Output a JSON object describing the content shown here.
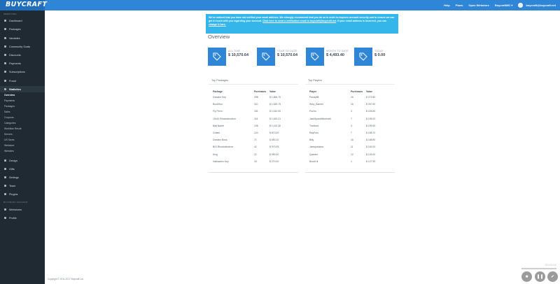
{
  "header": {
    "logo": "BUYCRAFT",
    "links": [
      "Help",
      "Plans",
      "Open Webstore",
      "BuycraftMC ▾"
    ],
    "user_email": "buycraft@buycraft.net",
    "colors": {
      "topbar": "#2f86d6",
      "sidebar": "#1f2a33",
      "accent": "#2f86d6",
      "notice": "#34b6eb"
    }
  },
  "sidebar": {
    "section_webstore": "WEBSTORE",
    "items_top": [
      {
        "label": "Dashboard",
        "icon": "dashboard-icon"
      },
      {
        "label": "Packages",
        "icon": "package-icon"
      },
      {
        "label": "Variables",
        "icon": "variable-icon"
      },
      {
        "label": "Community Goals",
        "icon": "goal-icon"
      },
      {
        "label": "Discounts",
        "icon": "discount-icon"
      },
      {
        "label": "Payments",
        "icon": "payment-icon"
      },
      {
        "label": "Subscriptions",
        "icon": "subscription-icon"
      },
      {
        "label": "Fraud",
        "icon": "fraud-icon"
      },
      {
        "label": "Statistics",
        "icon": "statistics-icon"
      }
    ],
    "stat_sub": [
      "Overview",
      "Payments",
      "Packages",
      "Sales",
      "Coupons",
      "Categories",
      "Workflow Result",
      "Servers",
      "US Taxes",
      "Webstore",
      "Websites"
    ],
    "items_mid": [
      {
        "label": "Design",
        "icon": "design-icon"
      },
      {
        "label": "Gifts",
        "icon": "gift-icon"
      },
      {
        "label": "Settings",
        "icon": "settings-icon"
      },
      {
        "label": "Team",
        "icon": "team-icon"
      },
      {
        "label": "Plugins",
        "icon": "plugin-icon"
      }
    ],
    "section_account": "BUYCRAFT ACCOUNT",
    "items_bottom": [
      {
        "label": "Webstores",
        "icon": "webstore-icon"
      },
      {
        "label": "Profile",
        "icon": "profile-icon"
      }
    ]
  },
  "notice": {
    "text1": "We've noticed that you have not verified your email address. We strongly recommend that you do so in order to improve account security and to ensure we can get in touch with you regarding your account.",
    "link1": "Click here to send a verification email to buycraft@buycraft.net",
    "text2": ". If your email address is incorrect, you can",
    "link2": "change it here."
  },
  "page": {
    "title": "Overview"
  },
  "stats": [
    {
      "label": "ALL TIME",
      "value": "$ 10,570.64"
    },
    {
      "label": "YEAR TO DATE",
      "value": "$ 10,570.64"
    },
    {
      "label": "MONTH TO DATE",
      "value": "$ 4,493.40"
    },
    {
      "label": "TODAY",
      "value": "$ 0.00"
    }
  ],
  "top_packages": {
    "title": "Top Packages",
    "headers": [
      "Package",
      "Purchases",
      "Value"
    ],
    "rows": [
      [
        "Donator Key",
        "298",
        "$ 1,666.70"
      ],
      [
        "BookSun",
        "110",
        "$ 1,549.75"
      ],
      [
        "Fly Perm",
        "151",
        "$ 1,510.00"
      ],
      [
        "10x10 Rhododendron",
        "114",
        "$ 1,620.21"
      ],
      [
        "Bait Name",
        "108",
        "$ 1,410.30"
      ],
      [
        "Crates",
        "124",
        "$ 870.20"
      ],
      [
        "Donator Boss",
        "71",
        "$ 650.10"
      ],
      [
        "BIG Rhododendron",
        "42",
        "$ 970.05"
      ],
      [
        "King",
        "22",
        "$ 550.00"
      ],
      [
        "Halloween Key",
        "15",
        "$ 270.00"
      ]
    ]
  },
  "top_players": {
    "title": "Top Players",
    "headers": [
      "Player",
      "Purchases",
      "Value"
    ],
    "rows": [
      [
        "Panay88",
        "16",
        "$ 272.80"
      ],
      [
        "Wizy_Banner",
        "16",
        "$ 267.90"
      ],
      [
        "Pochu",
        "3",
        "$ 226.50"
      ],
      [
        "JackSpaceMinecraft",
        "7",
        "$ 199.20"
      ],
      [
        "Tradiuno",
        "3",
        "$ 199.90"
      ],
      [
        "RayPoro",
        "7",
        "$ 168.70"
      ],
      [
        "Billy",
        "16",
        "$ 168.50"
      ],
      [
        "Jamojustsina",
        "11",
        "$ 162.00"
      ],
      [
        "Quester",
        "12",
        "$ 126.00"
      ],
      [
        "Brooft ill",
        "1",
        "$ 127.90"
      ]
    ]
  },
  "footer": {
    "copyright": "Copyright © 2011-2017 Buycraft Ltd."
  },
  "media": {
    "time": "00:00:04"
  }
}
